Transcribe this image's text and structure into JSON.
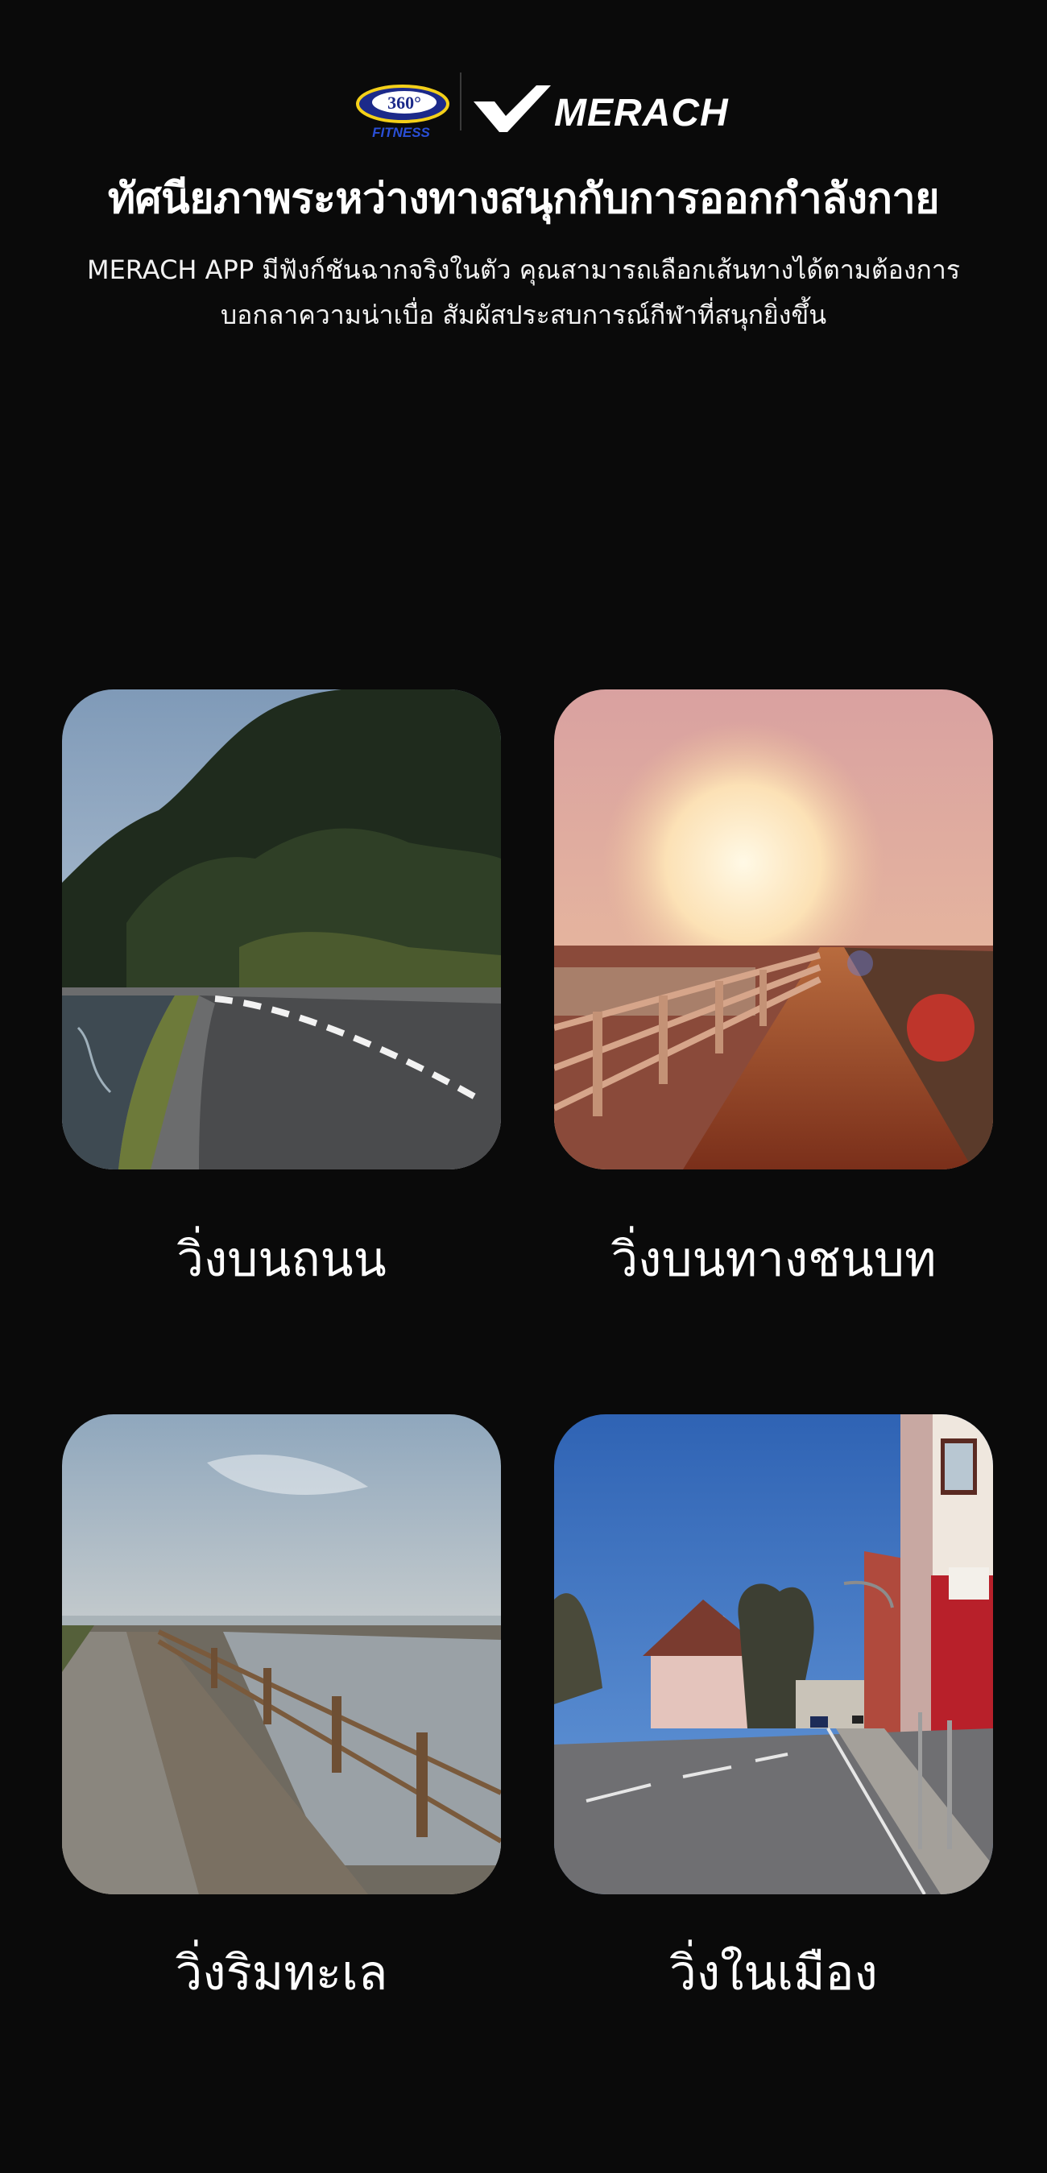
{
  "brand": {
    "partner_logo_text": "360°",
    "partner_logo_subtext": "FITNESS",
    "brand_name": "MERACH"
  },
  "headline": "ทัศนียภาพระหว่างทางสนุกกับการออกกำลังกาย",
  "description": {
    "line1": "MERACH APP มีฟังก์ชันฉากจริงในตัว คุณสามารถเลือกเส้นทางได้ตามต้องการ",
    "line2": "บอกลาความน่าเบื่อ สัมผัสประสบการณ์กีฬาที่สนุกยิ่งขึ้น"
  },
  "routes": [
    {
      "label": "วิ่งบนถนน"
    },
    {
      "label": "วิ่งบนทางชนบท"
    },
    {
      "label": "วิ่งริมทะเล"
    },
    {
      "label": "วิ่งในเมือง"
    }
  ],
  "colors": {
    "background": "#0a0a0a",
    "text": "#ffffff",
    "logo_360_blue": "#1c2a8a",
    "logo_360_yellow": "#f4d019"
  }
}
